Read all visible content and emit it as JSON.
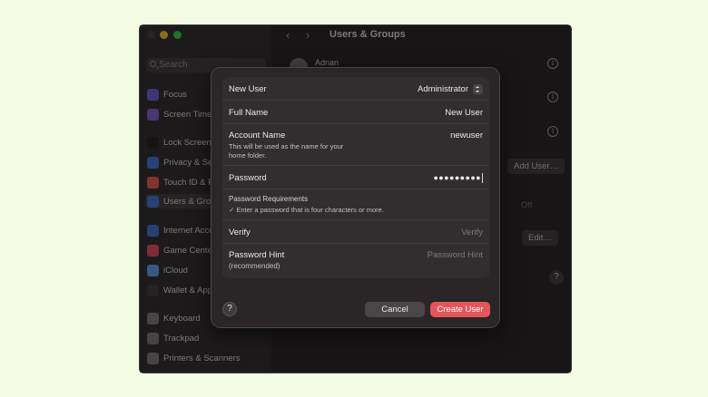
{
  "window": {
    "title": "Users & Groups",
    "search_placeholder": "Search"
  },
  "sidebar": {
    "items": [
      {
        "label": "Focus",
        "color": "#6b5bd6"
      },
      {
        "label": "Screen Time",
        "color": "#7a5ad0"
      },
      {
        "label": "Lock Screen",
        "color": "#2c2a2b"
      },
      {
        "label": "Privacy & Security",
        "color": "#3c6fd0"
      },
      {
        "label": "Touch ID & Password",
        "color": "#e0594e"
      },
      {
        "label": "Users & Groups",
        "color": "#3c6fd0"
      },
      {
        "label": "Internet Accounts",
        "color": "#3c6fd0"
      },
      {
        "label": "Game Center",
        "color": "#e04a5f"
      },
      {
        "label": "iCloud",
        "color": "#5e9ae6"
      },
      {
        "label": "Wallet & Apple Pay",
        "color": "#3a3a3a"
      },
      {
        "label": "Keyboard",
        "color": "#7a7677"
      },
      {
        "label": "Trackpad",
        "color": "#7a7677"
      },
      {
        "label": "Printers & Scanners",
        "color": "#7a7677"
      }
    ]
  },
  "background_panel": {
    "user_name": "Adnan",
    "add_user_label": "Add User…",
    "off_label": "Off",
    "edit_label": "Edit…",
    "help_label": "?"
  },
  "dialog": {
    "new_user_label": "New User",
    "new_user_value": "Administrator",
    "full_name_label": "Full Name",
    "full_name_value": "New User",
    "account_name_label": "Account Name",
    "account_name_hint_line1": "This will be used as the name for your",
    "account_name_hint_line2": "home folder.",
    "account_name_value": "newuser",
    "password_label": "Password",
    "password_value": "●●●●●●●●●",
    "requirements_label": "Password Requirements",
    "requirements_text": "✓ Enter a password that is four characters or more.",
    "verify_label": "Verify",
    "verify_placeholder": "Verify",
    "hint_label": "Password Hint",
    "hint_sub": "(recommended)",
    "hint_placeholder": "Password Hint",
    "help_label": "?",
    "cancel_label": "Cancel",
    "create_label": "Create User"
  }
}
